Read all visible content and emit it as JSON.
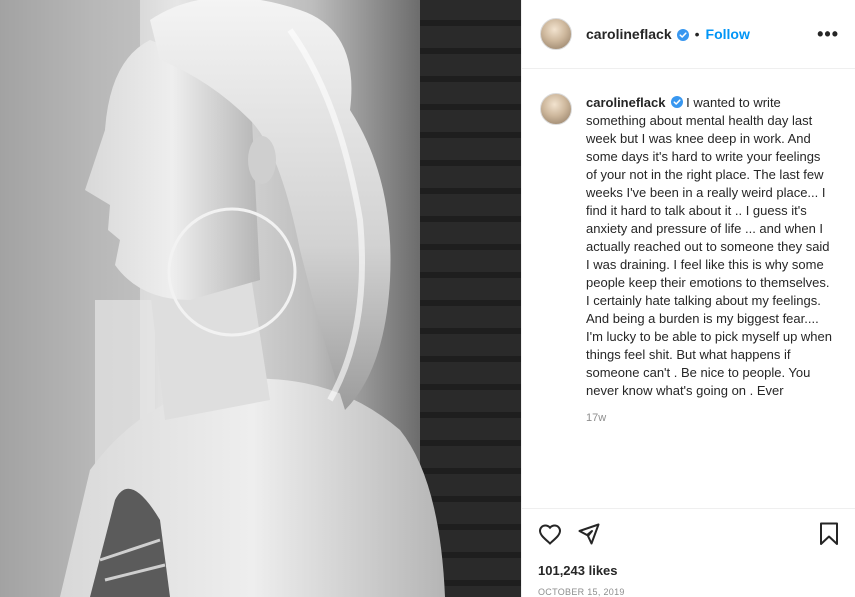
{
  "post": {
    "username": "carolineflack",
    "verified": true,
    "follow_label": "Follow",
    "separator": "•",
    "more_icon": "more-horizontal-icon",
    "caption": "I wanted to write something about mental health day last week but I was knee deep in work. And some days it's hard to write your feelings of your not in the right place. The last few weeks I've been in a really weird place... I find it hard to talk about it .. I guess it's anxiety and pressure of life ... and when I actually reached out to someone they said I was draining. I feel like this is why some people keep their emotions to themselves. I certainly hate talking about my feelings. And being a burden is my biggest fear.... I'm lucky to be able to pick myself up when things feel shit. But what happens if someone can't . Be nice to people. You never know what's going on . Ever",
    "caption_age": "17w",
    "likes": "101,243 likes",
    "date": "OCTOBER 15, 2019"
  },
  "icons": {
    "like": "heart-icon",
    "share": "paper-plane-icon",
    "save": "bookmark-icon",
    "verified": "verified-badge-icon"
  },
  "colors": {
    "link_blue": "#0095f6",
    "verified_blue": "#3897f0",
    "text": "#262626",
    "muted": "#8e8e8e"
  }
}
